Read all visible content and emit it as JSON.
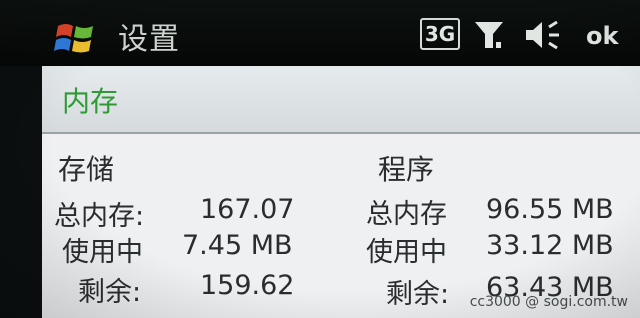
{
  "titlebar": {
    "title": "设置",
    "network_badge": "3G",
    "ok_label": "ok",
    "icons": [
      "windows-start-icon",
      "signal-icon",
      "speaker-icon"
    ]
  },
  "page": {
    "title": "内存"
  },
  "storage": {
    "heading": "存储",
    "total_label": "总内存:",
    "total_value": "167.07",
    "used_label": "使用中",
    "used_value": "7.45 MB",
    "free_label": "剩余:",
    "free_value": "159.62"
  },
  "program": {
    "heading": "程序",
    "total_label": "总内存",
    "total_value": "96.55 MB",
    "used_label": "使用中",
    "used_value": "33.12 MB",
    "free_label": "剩余:",
    "free_value": "63.43 MB"
  },
  "watermark": "cc3000   @ sogi.com.tw",
  "colors": {
    "accent": "#2e9a33",
    "titlebar": "#0b0f10",
    "screen": "#eef0f1"
  }
}
